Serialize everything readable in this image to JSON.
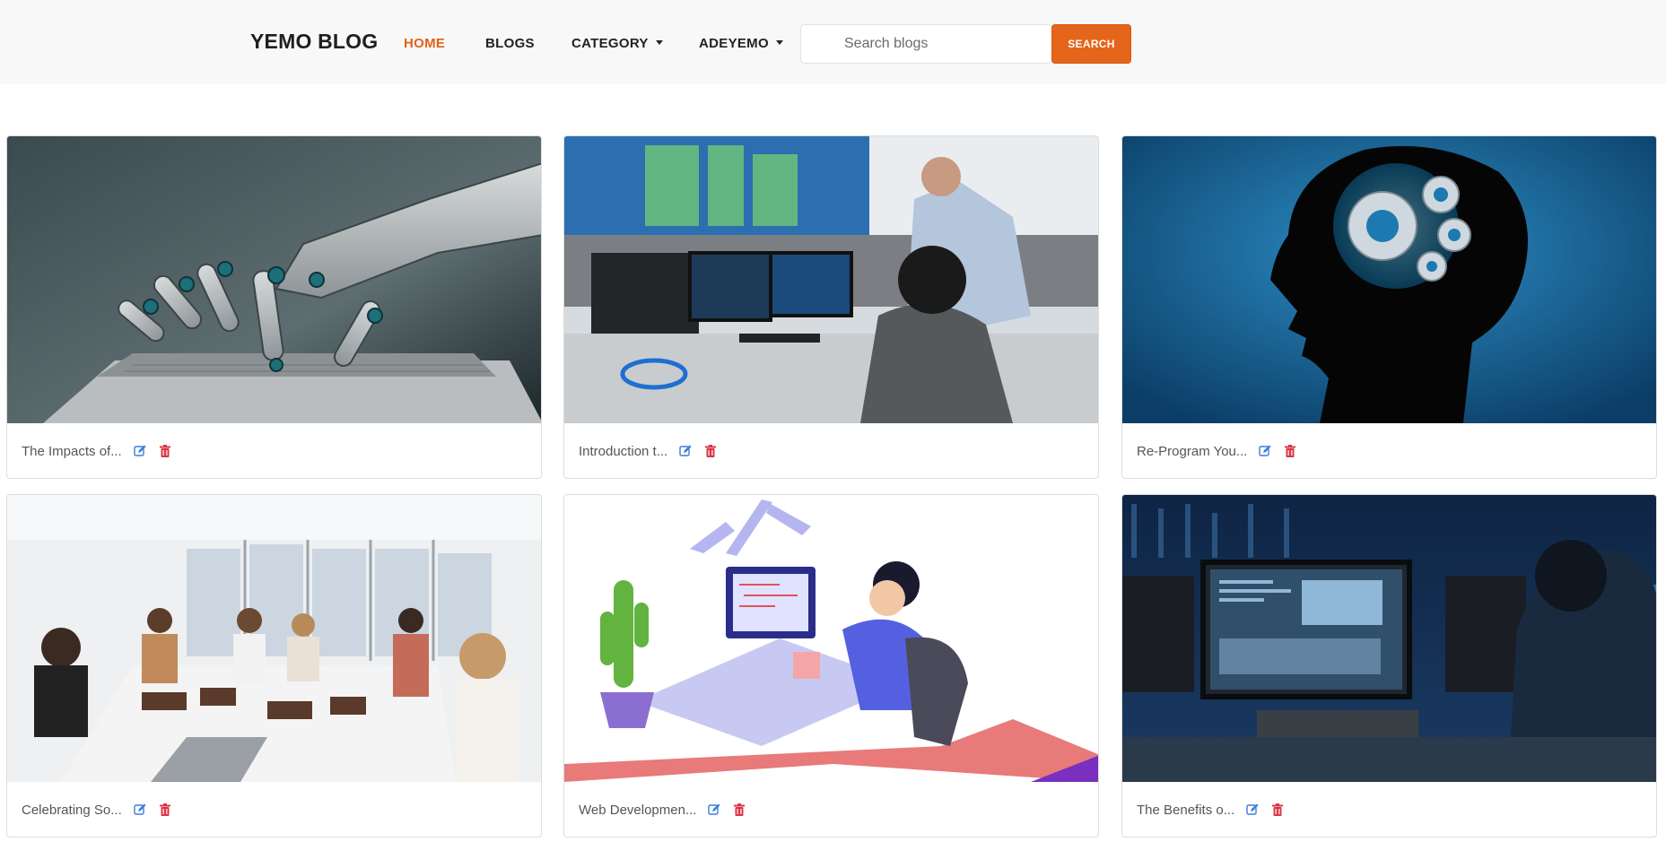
{
  "navbar": {
    "brand": "YEMO BLOG",
    "items": [
      {
        "label": "HOME",
        "active": true
      },
      {
        "label": "BLOGS"
      },
      {
        "label": "CATEGORY",
        "dropdown": true
      },
      {
        "label": "ADEYEMO",
        "dropdown": true
      }
    ],
    "search": {
      "placeholder": "Search blogs",
      "value": "",
      "button_label": "SEARCH"
    }
  },
  "colors": {
    "accent": "#e5651a",
    "edit_icon": "#3b7ddd",
    "delete_icon": "#dc3545"
  },
  "posts": [
    {
      "title": "The Impacts of...",
      "image": "robot-hand-on-laptop"
    },
    {
      "title": "Introduction t...",
      "image": "engineers-at-monitors"
    },
    {
      "title": "Re-Program You...",
      "image": "head-silhouette-with-gears"
    },
    {
      "title": "Celebrating So...",
      "image": "women-in-office-meeting"
    },
    {
      "title": "Web Developmen...",
      "image": "developer-illustration"
    },
    {
      "title": "The Benefits o...",
      "image": "programmer-at-screens"
    }
  ]
}
